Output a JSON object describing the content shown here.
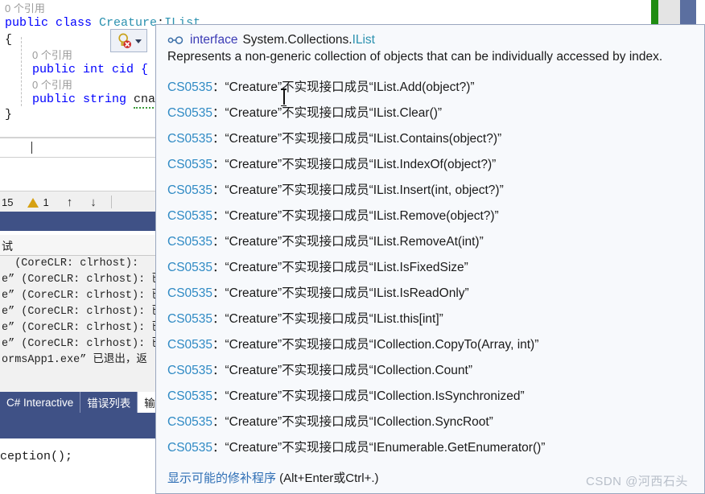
{
  "editor": {
    "ref_hint_1": "0 个引用",
    "line_class_prefix": "public class ",
    "line_class_name": "Creature",
    "line_class_colon": ":",
    "line_class_iface": "IList",
    "brace_open": "{",
    "ref_hint_2": "0 个引用",
    "prop_int": "public int cid { ge",
    "ref_hint_3": "0 个引用",
    "prop_string_kw": "public string ",
    "prop_string_name": "cname",
    "brace_close": "}"
  },
  "error_list": {
    "error_count": "15",
    "warning_count": "1",
    "up_arrow": "↑",
    "down_arrow": "↓"
  },
  "output": {
    "header": "试",
    "lines": [
      "  (CoreCLR: clrhost):",
      "e” (CoreCLR: clrhost): 已",
      "e” (CoreCLR: clrhost): 已",
      "e” (CoreCLR: clrhost): 已",
      "e” (CoreCLR: clrhost): 已",
      "e” (CoreCLR: clrhost): 已",
      "ormsApp1.exe” 已退出，返"
    ]
  },
  "tabs": [
    {
      "label": "C# Interactive",
      "active": false
    },
    {
      "label": "错误列表",
      "active": false
    },
    {
      "label": "输",
      "active": true
    }
  ],
  "bottom_code": {
    "line": "ception();"
  },
  "tooltip": {
    "icon": "interface-icon",
    "header_keyword": "interface",
    "header_namespace": "System.Collections.",
    "header_type": "IList",
    "description": "Represents a non-generic collection of objects that can be individually accessed by index.",
    "diagnostics": [
      {
        "code": "CS0535",
        "message": "：“Creature”不实现接口成员“IList.Add(object?)”"
      },
      {
        "code": "CS0535",
        "message": "：“Creature”不实现接口成员“IList.Clear()”"
      },
      {
        "code": "CS0535",
        "message": "：“Creature”不实现接口成员“IList.Contains(object?)”"
      },
      {
        "code": "CS0535",
        "message": "：“Creature”不实现接口成员“IList.IndexOf(object?)”"
      },
      {
        "code": "CS0535",
        "message": "：“Creature”不实现接口成员“IList.Insert(int, object?)”"
      },
      {
        "code": "CS0535",
        "message": "：“Creature”不实现接口成员“IList.Remove(object?)”"
      },
      {
        "code": "CS0535",
        "message": "：“Creature”不实现接口成员“IList.RemoveAt(int)”"
      },
      {
        "code": "CS0535",
        "message": "：“Creature”不实现接口成员“IList.IsFixedSize”"
      },
      {
        "code": "CS0535",
        "message": "：“Creature”不实现接口成员“IList.IsReadOnly”"
      },
      {
        "code": "CS0535",
        "message": "：“Creature”不实现接口成员“IList.this[int]”"
      },
      {
        "code": "CS0535",
        "message": "：“Creature”不实现接口成员“ICollection.CopyTo(Array, int)”"
      },
      {
        "code": "CS0535",
        "message": "：“Creature”不实现接口成员“ICollection.Count”"
      },
      {
        "code": "CS0535",
        "message": "：“Creature”不实现接口成员“ICollection.IsSynchronized”"
      },
      {
        "code": "CS0535",
        "message": "：“Creature”不实现接口成员“ICollection.SyncRoot”"
      },
      {
        "code": "CS0535",
        "message": "：“Creature”不实现接口成员“IEnumerable.GetEnumerator()”"
      }
    ],
    "fix_link_text": "显示可能的修补程序",
    "fix_link_shortcut": " (Alt+Enter或Ctrl+.)"
  },
  "watermark": "CSDN @河西石头",
  "colors": {
    "accent_blue": "#3f5186",
    "link_blue": "#2f8ac4",
    "keyword_blue": "#0000ff",
    "type_teal": "#2b91af",
    "error_red": "#d41313",
    "warning_gold": "#d6a113",
    "strip_green": "#1f8c12"
  }
}
